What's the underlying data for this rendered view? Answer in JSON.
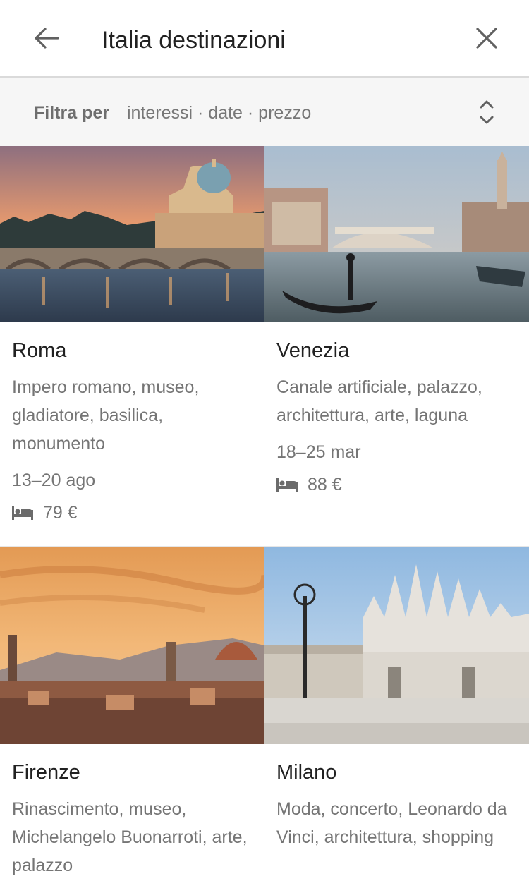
{
  "header": {
    "title": "Italia destinazioni",
    "back_icon": "arrow-back-icon",
    "close_icon": "close-icon"
  },
  "filter": {
    "label": "Filtra per",
    "values": "interessi · date · prezzo",
    "expand_icon": "unfold-more-icon"
  },
  "destinations": [
    {
      "name": "Roma",
      "description": "Impero romano, museo, gladiatore, basilica, monumento",
      "dates": "13–20 ago",
      "price": "79 €",
      "photo": "rome-st-peters-basilica-at-sunset"
    },
    {
      "name": "Venezia",
      "description": "Canale artificiale, palazzo, architettura, arte, laguna",
      "dates": "18–25 mar",
      "price": "88 €",
      "photo": "venice-grand-canal-gondola-rialto"
    },
    {
      "name": "Firenze",
      "description": "Rinascimento, museo, Michelangelo Buonarroti, arte, palazzo",
      "photo": "florence-skyline-duomo-sunset"
    },
    {
      "name": "Milano",
      "description": "Moda, concerto, Leonardo da Vinci, architettura, shopping",
      "photo": "milan-duomo-cathedral-square"
    }
  ],
  "colors": {
    "text_primary": "#212121",
    "text_secondary": "#757575",
    "filter_bg": "#f6f6f6",
    "divider": "#dadada"
  }
}
